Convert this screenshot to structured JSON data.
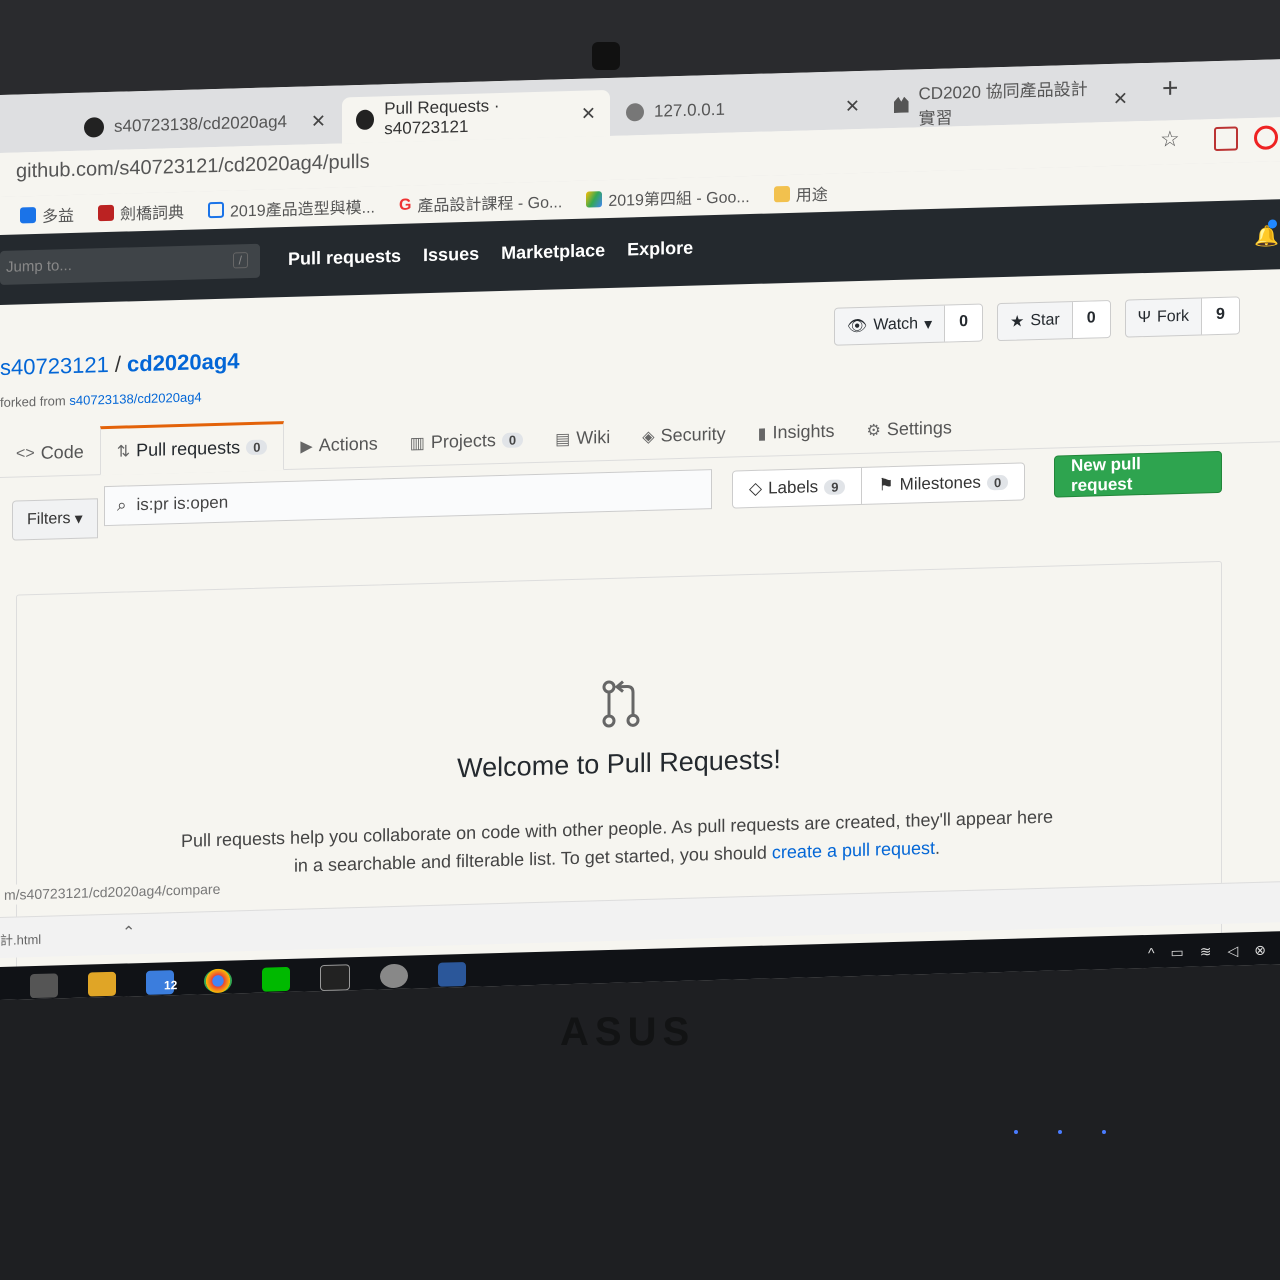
{
  "browser": {
    "tabs": [
      {
        "label": "s40723138/cd2020ag4",
        "active": false
      },
      {
        "label": "Pull Requests · s40723121",
        "active": true
      },
      {
        "label": "127.0.0.1",
        "active": false
      },
      {
        "label": "CD2020 協同產品設計實習",
        "active": false
      }
    ],
    "url": "github.com/s40723121/cd2020ag4/pulls",
    "bookmarks": [
      "多益",
      "劍橋詞典",
      "2019產品造型與模...",
      "產品設計課程 - Go...",
      "2019第四組 - Goo...",
      "用途"
    ]
  },
  "gh_header": {
    "search_placeholder": "Jump to...",
    "search_key": "/",
    "nav": [
      "Pull requests",
      "Issues",
      "Marketplace",
      "Explore"
    ]
  },
  "repo": {
    "owner": "s40723121",
    "name": "cd2020ag4",
    "forked_label": "forked from",
    "forked_from": "s40723138/cd2020ag4",
    "watch": {
      "label": "Watch",
      "count": "0"
    },
    "star": {
      "label": "Star",
      "count": "0"
    },
    "fork": {
      "label": "Fork",
      "count": "9"
    },
    "tabs": [
      {
        "label": "Code"
      },
      {
        "label": "Pull requests",
        "count": "0"
      },
      {
        "label": "Actions"
      },
      {
        "label": "Projects",
        "count": "0"
      },
      {
        "label": "Wiki"
      },
      {
        "label": "Security"
      },
      {
        "label": "Insights"
      },
      {
        "label": "Settings"
      }
    ]
  },
  "filters": {
    "button": "Filters",
    "query": "is:pr is:open",
    "labels": {
      "label": "Labels",
      "count": "9"
    },
    "milestones": {
      "label": "Milestones",
      "count": "0"
    },
    "new_pr": "New pull request"
  },
  "blankslate": {
    "title": "Welcome to Pull Requests!",
    "desc_1": "Pull requests help you collaborate on code with other people. As pull requests are created, they'll appear here in a searchable and filterable list. To get started, you should",
    "desc_link": "create a pull request",
    "desc_end": "."
  },
  "status_url": "m/s40723121/cd2020ag4/compare",
  "download": {
    "file": "計.html"
  },
  "taskbar": {
    "mail_count": "12"
  },
  "laptop": {
    "brand": "ASUS"
  }
}
